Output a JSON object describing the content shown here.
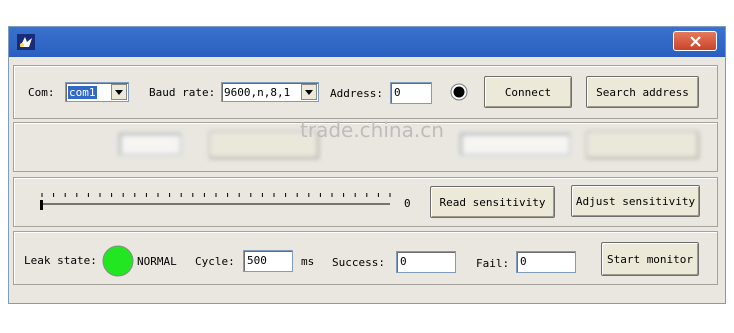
{
  "connection": {
    "com_label": "Com:",
    "com_value": "com1",
    "baud_label": "Baud rate:",
    "baud_value": "9600,n,8,1",
    "address_label": "Address:",
    "address_value": "0",
    "connect_label": "Connect",
    "search_label": "Search address"
  },
  "watermark": "trade.china.cn",
  "sensitivity": {
    "value": "0",
    "slider_level": 0,
    "read_label": "Read sensitivity",
    "adjust_label": "Adjust sensitivity"
  },
  "monitor": {
    "leak_label": "Leak state:",
    "leak_status": "NORMAL",
    "leak_color": "#22e622",
    "cycle_label": "Cycle:",
    "cycle_value": "500",
    "cycle_unit": "ms",
    "success_label": "Success:",
    "success_value": "0",
    "fail_label": "Fail:",
    "fail_value": "0",
    "start_label": "Start monitor"
  }
}
